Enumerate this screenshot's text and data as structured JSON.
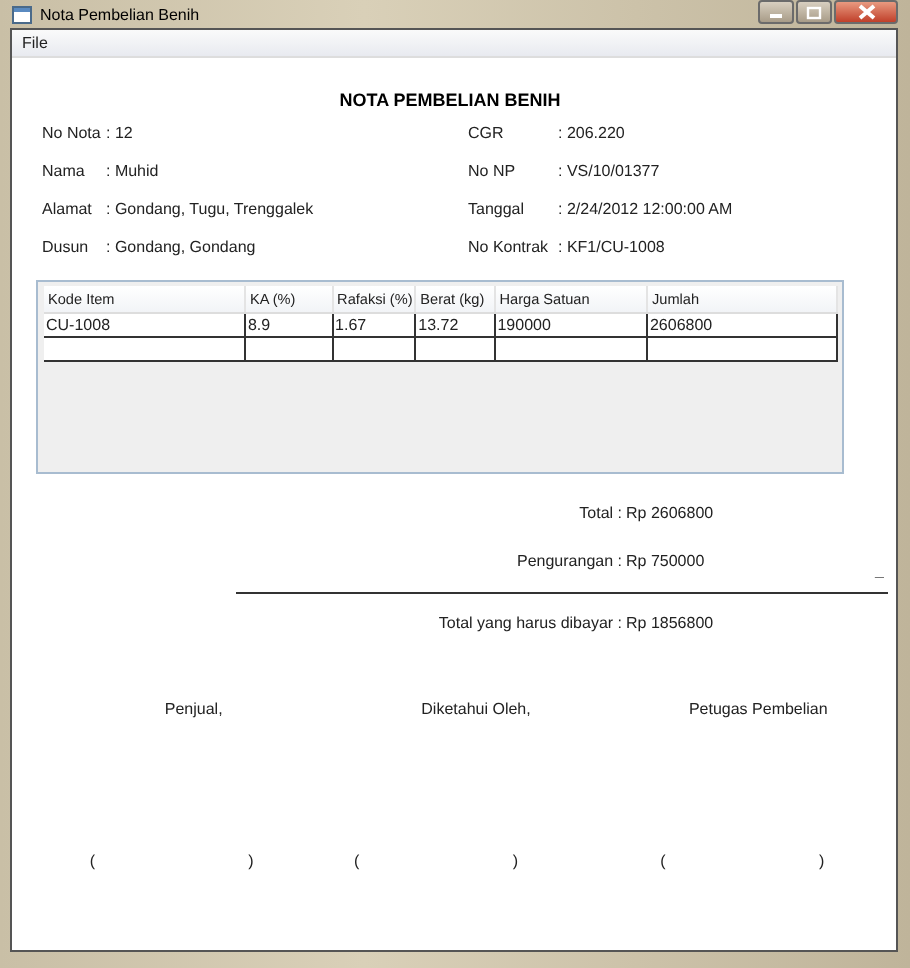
{
  "window": {
    "title": "Nota Pembelian Benih"
  },
  "menu": [
    "File"
  ],
  "heading": "NOTA PEMBELIAN BENIH",
  "info_left": [
    {
      "label": "No Nota",
      "value": ": 12"
    },
    {
      "label": "Nama",
      "value": ": Muhid"
    },
    {
      "label": "Alamat",
      "value": ": Gondang, Tugu, Trenggalek"
    },
    {
      "label": "Dusun",
      "value": ": Gondang, Gondang"
    }
  ],
  "info_right": [
    {
      "label": "CGR",
      "value": ": 206.220"
    },
    {
      "label": "No NP",
      "value": ": VS/10/01377"
    },
    {
      "label": "Tanggal",
      "value": ": 2/24/2012 12:00:00 AM"
    },
    {
      "label": "No Kontrak",
      "value": ": KF1/CU-1008"
    }
  ],
  "table": {
    "columns": [
      "Kode Item",
      "KA (%)",
      "Rafaksi (%)",
      "Berat (kg)",
      "Harga Satuan",
      "Jumlah"
    ],
    "rows": [
      [
        "CU-1008",
        "8.9",
        "1.67",
        "13.72",
        "190000",
        "2606800"
      ]
    ]
  },
  "totals": [
    {
      "label": "Total :",
      "value": "Rp 2606800"
    },
    {
      "label": "Pengurangan :",
      "value": "Rp 750000",
      "minus": "_"
    },
    {
      "label": "Total yang harus dibayar :",
      "value": "Rp 1856800"
    }
  ],
  "signatures": [
    {
      "label": "Penjual,",
      "open": "(",
      "close": ")"
    },
    {
      "label": "Diketahui Oleh,",
      "open": "(",
      "close": ")"
    },
    {
      "label": "Petugas Pembelian",
      "open": "(",
      "close": ")"
    }
  ]
}
